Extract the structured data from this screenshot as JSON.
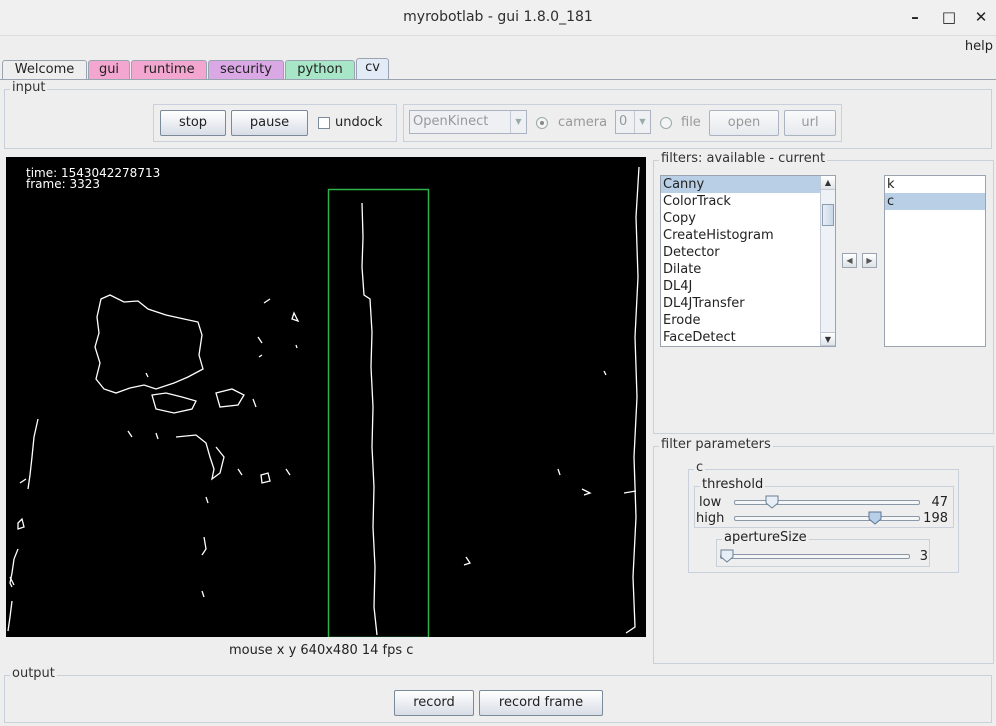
{
  "window": {
    "title": "myrobotlab - gui 1.8.0_181",
    "minimize_label": "–",
    "maximize_label": "□",
    "close_label": "✕"
  },
  "menu": {
    "help": "help"
  },
  "tabs": [
    {
      "label": "Welcome",
      "color": "#eeeeee"
    },
    {
      "label": "gui",
      "color": "#f3a6cf"
    },
    {
      "label": "runtime",
      "color": "#f3a6cf"
    },
    {
      "label": "security",
      "color": "#dba8e6"
    },
    {
      "label": "python",
      "color": "#a8e6c8"
    },
    {
      "label": "cv",
      "color": "#e3ecf6"
    }
  ],
  "input": {
    "label": "input",
    "stop": "stop",
    "pause": "pause",
    "undock": "undock",
    "grabber": "OpenKinect",
    "camera_label": "camera",
    "camera_index": "0",
    "file_label": "file",
    "open": "open",
    "url": "url"
  },
  "video": {
    "time": "time:  1543042278713",
    "frame": "frame: 3323",
    "roi_color": "#2fb24a"
  },
  "status": "mouse x y  640x480  14 fps  c",
  "filters": {
    "label": "filters: available - current",
    "available": [
      "Canny",
      "ColorTrack",
      "Copy",
      "CreateHistogram",
      "Detector",
      "Dilate",
      "DL4J",
      "DL4JTransfer",
      "Erode",
      "FaceDetect"
    ],
    "selected_available": 0,
    "current": [
      "k",
      "c"
    ],
    "selected_current": 1
  },
  "params": {
    "label": "filter parameters",
    "filter_name": "c",
    "threshold_label": "threshold",
    "low_label": "low",
    "low_value": "47",
    "low_fraction": 0.18,
    "high_label": "high",
    "high_value": "198",
    "high_fraction": 0.78,
    "aperture_label": "apertureSize",
    "aperture_value": "3",
    "aperture_fraction": 0.0
  },
  "output": {
    "label": "output",
    "record": "record",
    "record_frame": "record frame"
  }
}
